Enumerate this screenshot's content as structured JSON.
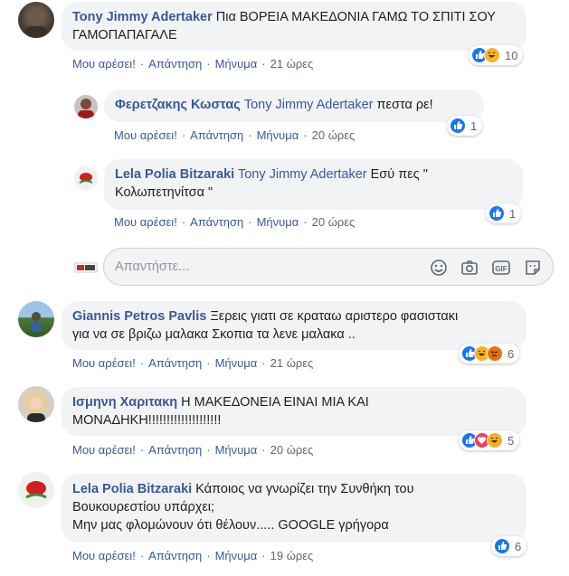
{
  "comments": [
    {
      "author": "Tony Jimmy Adertaker",
      "text": "Πια ΒΟΡΕΙΑ ΜΑΚΕΔΟΝΙΑ ΓΑΜΩ ΤΟ ΣΠΙΤΙ ΣΟΥ ΓΑΜΟΠΑΠΑΓΑΛΕ",
      "like": "Μου αρέσει!",
      "reply": "Απάντηση",
      "message": "Μήνυμα",
      "time": "21 ώρες",
      "reaction_count": "10",
      "reactions": [
        "like",
        "haha"
      ]
    },
    {
      "author": "Φερετζακης Κωστας",
      "mention": "Tony Jimmy Adertaker",
      "text": "πεστα ρε!",
      "like": "Μου αρέσει!",
      "reply": "Απάντηση",
      "message": "Μήνυμα",
      "time": "20 ώρες",
      "reaction_count": "1",
      "reactions": [
        "like"
      ]
    },
    {
      "author": "Lela Polia Bitzaraki",
      "mention": "Tony Jimmy Adertaker",
      "text_line1": "Εσύ πες \"",
      "text_line2": "Κολωπετηνίτσα \"",
      "like": "Μου αρέσει!",
      "reply": "Απάντηση",
      "message": "Μήνυμα",
      "time": "20 ώρες",
      "reaction_count": "1",
      "reactions": [
        "like"
      ]
    },
    {
      "author": "Giannis Petros Pavlis",
      "text_line1": "Ξερεις γιατι σε κραταω αριστερο φασιστακι",
      "text_line2": "για να σε βριζω μαλακα Σκοπια τα λενε μαλακα ..",
      "like": "Μου αρέσει!",
      "reply": "Απάντηση",
      "message": "Μήνυμα",
      "time": "21 ώρες",
      "reaction_count": "6",
      "reactions": [
        "like",
        "haha",
        "angry"
      ]
    },
    {
      "author": "Ισμηνη Χαριτακη",
      "text_line1": "Η ΜΑΚΕΔΟΝΕΙΑ ΕΙΝΑΙ ΜΙΑ ΚΑΙ",
      "text_line2": "ΜΟΝΑΔΗΚΗ!!!!!!!!!!!!!!!!!!!!",
      "like": "Μου αρέσει!",
      "reply": "Απάντηση",
      "message": "Μήνυμα",
      "time": "20 ώρες",
      "reaction_count": "5",
      "reactions": [
        "like",
        "love",
        "haha"
      ]
    },
    {
      "author": "Lela Polia Bitzaraki",
      "text_line1": "Κάποιος να γνωρίζει την Συνθήκη του",
      "text_line2": "Βουκουρεστίου υπάρχει;",
      "text_line3": "Μην μας φλομώνουν ότι θέλουν..... GOOGLE γρήγορα",
      "like": "Μου αρέσει!",
      "reply": "Απάντηση",
      "message": "Μήνυμα",
      "time": "19 ώρες",
      "reaction_count": "6",
      "reactions": [
        "like"
      ]
    }
  ],
  "reply_box": {
    "placeholder": "Απαντήστε...",
    "icons": [
      "emoji-icon",
      "camera-icon",
      "gif-icon",
      "sticker-icon"
    ]
  },
  "colors": {
    "link": "#385898",
    "bubble": "#f2f3f5",
    "meta": "#606770",
    "like": "#1877f2",
    "haha": "#f7b125",
    "angry": "#e9710f",
    "love": "#f33e58"
  }
}
